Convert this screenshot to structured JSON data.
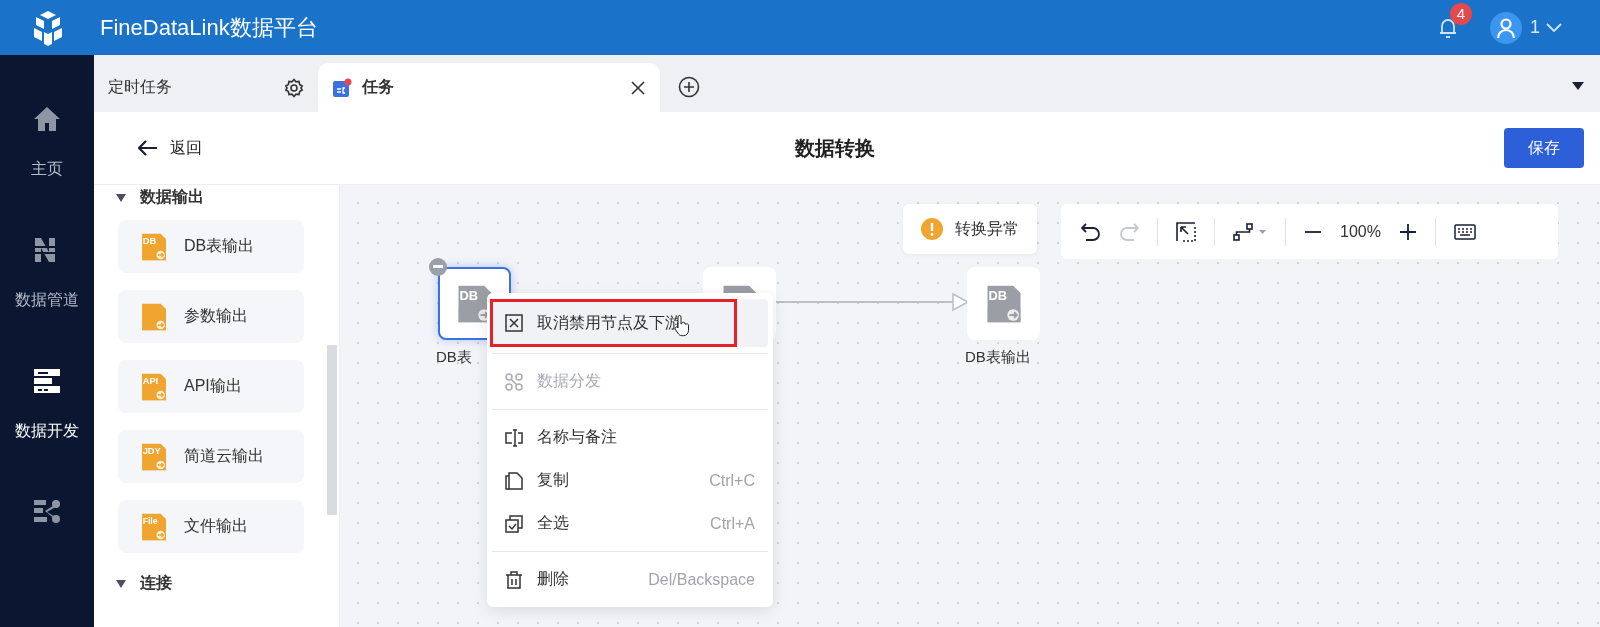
{
  "app": {
    "title": "FineDataLink数据平台",
    "notifications": "4",
    "user": "1"
  },
  "nav": [
    {
      "label": "主页",
      "selected": false
    },
    {
      "label": "数据管道",
      "selected": false
    },
    {
      "label": "数据开发",
      "selected": true
    },
    {
      "selected": false
    }
  ],
  "tabs": [
    {
      "label": "定时任务",
      "selected": false
    },
    {
      "label": "任务",
      "selected": true
    }
  ],
  "header": {
    "back": "返回",
    "title": "数据转换",
    "save": "保存"
  },
  "palette": {
    "sections": [
      {
        "label": "数据输出",
        "expanded": true,
        "items": [
          {
            "label": "DB表输出",
            "badge": "DB"
          },
          {
            "label": "参数输出"
          },
          {
            "label": "API输出",
            "badge": "API"
          },
          {
            "label": "简道云输出",
            "badge": "JDY"
          },
          {
            "label": "文件输出",
            "badge": "File"
          }
        ]
      },
      {
        "label": "连接",
        "expanded": true
      }
    ]
  },
  "canvas": {
    "status": "转换异常",
    "zoom": "100%",
    "nodes": [
      {
        "label": "DB表",
        "icon_text": "DB",
        "selected": true,
        "disabled": true
      },
      {
        "selected": false,
        "disabled": false
      },
      {
        "label": "DB表输出",
        "icon_text": "DB",
        "selected": false,
        "disabled": false
      }
    ]
  },
  "context_menu": {
    "items": [
      {
        "kind": "item",
        "label": "取消禁用节点及下游",
        "hovered": true,
        "highlighted": true,
        "disabled": false
      },
      {
        "kind": "divider"
      },
      {
        "kind": "item",
        "label": "数据分发",
        "hovered": false,
        "highlighted": false,
        "disabled": true
      },
      {
        "kind": "divider"
      },
      {
        "kind": "item",
        "label": "名称与备注",
        "hovered": false,
        "highlighted": false,
        "disabled": false
      },
      {
        "kind": "item",
        "label": "复制",
        "shortcut": "Ctrl+C",
        "hovered": false,
        "highlighted": false,
        "disabled": false
      },
      {
        "kind": "item",
        "label": "全选",
        "shortcut": "Ctrl+A",
        "hovered": false,
        "highlighted": false,
        "disabled": false
      },
      {
        "kind": "divider"
      },
      {
        "kind": "item",
        "label": "删除",
        "shortcut": "Del/Backspace",
        "hovered": false,
        "highlighted": false,
        "disabled": false
      }
    ]
  }
}
